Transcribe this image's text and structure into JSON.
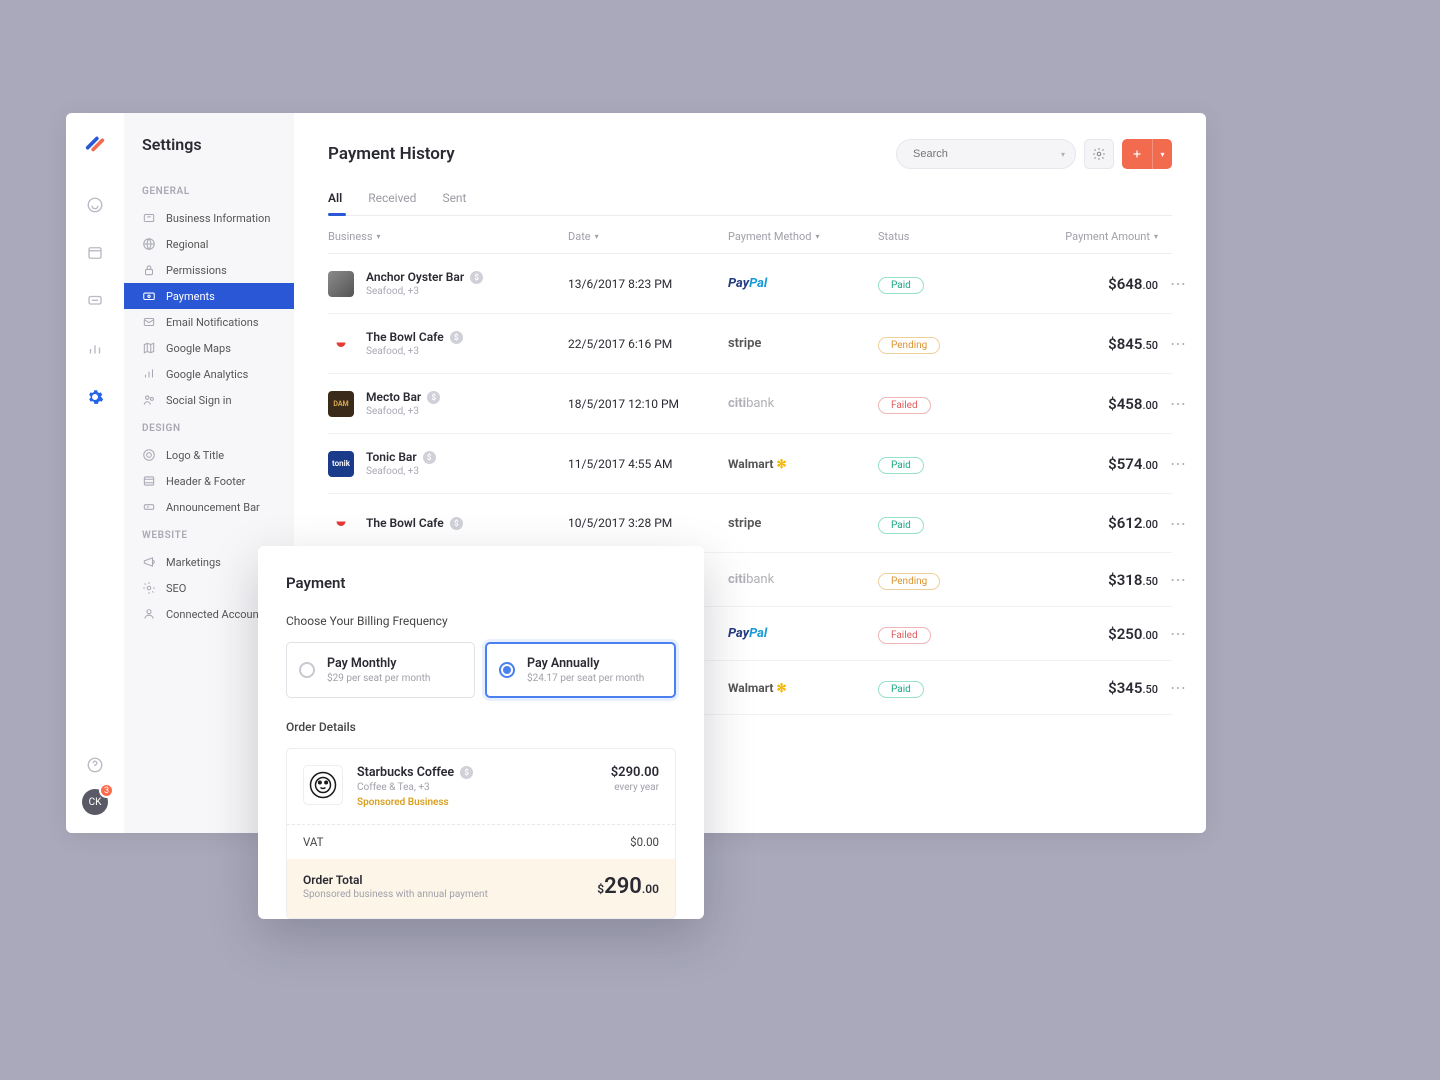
{
  "sidebar": {
    "title": "Settings",
    "sections": [
      {
        "label": "GENERAL",
        "items": [
          "Business Information",
          "Regional",
          "Permissions",
          "Payments",
          "Email Notifications",
          "Google Maps",
          "Google Analytics",
          "Social Sign in"
        ]
      },
      {
        "label": "DESIGN",
        "items": [
          "Logo & Title",
          "Header & Footer",
          "Announcement Bar"
        ]
      },
      {
        "label": "WEBSITE",
        "items": [
          "Marketings",
          "SEO",
          "Connected Accounts"
        ]
      }
    ],
    "active": "Payments"
  },
  "avatar": {
    "initials": "CK",
    "badge": "3"
  },
  "header": {
    "title": "Payment History",
    "search_placeholder": "Search"
  },
  "tabs": [
    "All",
    "Received",
    "Sent"
  ],
  "active_tab": "All",
  "columns": {
    "business": "Business",
    "date": "Date",
    "method": "Payment Method",
    "status": "Status",
    "amount": "Payment Amount"
  },
  "rows": [
    {
      "name": "Anchor Oyster Bar",
      "sub": "Seafood, +3",
      "date": "13/6/2017 8:23 PM",
      "method": "PayPal",
      "status": "Paid",
      "amount": "$648",
      "cents": ".00",
      "logo": "anchor"
    },
    {
      "name": "The Bowl Cafe",
      "sub": "Seafood, +3",
      "date": "22/5/2017 6:16 PM",
      "method": "stripe",
      "status": "Pending",
      "amount": "$845",
      "cents": ".50",
      "logo": "bowl"
    },
    {
      "name": "Mecto Bar",
      "sub": "Seafood, +3",
      "date": "18/5/2017 12:10 PM",
      "method": "citibank",
      "status": "Failed",
      "amount": "$458",
      "cents": ".00",
      "logo": "mecto"
    },
    {
      "name": "Tonic Bar",
      "sub": "Seafood, +3",
      "date": "11/5/2017 4:55 AM",
      "method": "Walmart",
      "status": "Paid",
      "amount": "$574",
      "cents": ".00",
      "logo": "tonic"
    },
    {
      "name": "The Bowl Cafe",
      "sub": "",
      "date": "10/5/2017 3:28 PM",
      "method": "stripe",
      "status": "Paid",
      "amount": "$612",
      "cents": ".00",
      "logo": "bowl"
    },
    {
      "name": "",
      "sub": "",
      "date": "",
      "method": "citibank",
      "status": "Pending",
      "amount": "$318",
      "cents": ".50",
      "logo": ""
    },
    {
      "name": "",
      "sub": "",
      "date": "",
      "method": "PayPal",
      "status": "Failed",
      "amount": "$250",
      "cents": ".00",
      "logo": ""
    },
    {
      "name": "",
      "sub": "",
      "date": "",
      "method": "Walmart",
      "status": "Paid",
      "amount": "$345",
      "cents": ".50",
      "logo": ""
    }
  ],
  "modal": {
    "title": "Payment",
    "frequency_label": "Choose Your Billing Frequency",
    "monthly": {
      "title": "Pay Monthly",
      "sub": "$29 per seat per month"
    },
    "annually": {
      "title": "Pay Annually",
      "sub": "$24.17 per seat per month"
    },
    "order_details_label": "Order Details",
    "order": {
      "name": "Starbucks Coffee",
      "sub": "Coffee & Tea, +3",
      "sponsor": "Sponsored Business",
      "price": "$290.00",
      "period": "every year"
    },
    "vat": {
      "label": "VAT",
      "value": "$0.00"
    },
    "total": {
      "label": "Order Total",
      "sub": "Sponsored business with annual payment",
      "currency": "$",
      "whole": "290",
      "cents": ".00"
    }
  }
}
